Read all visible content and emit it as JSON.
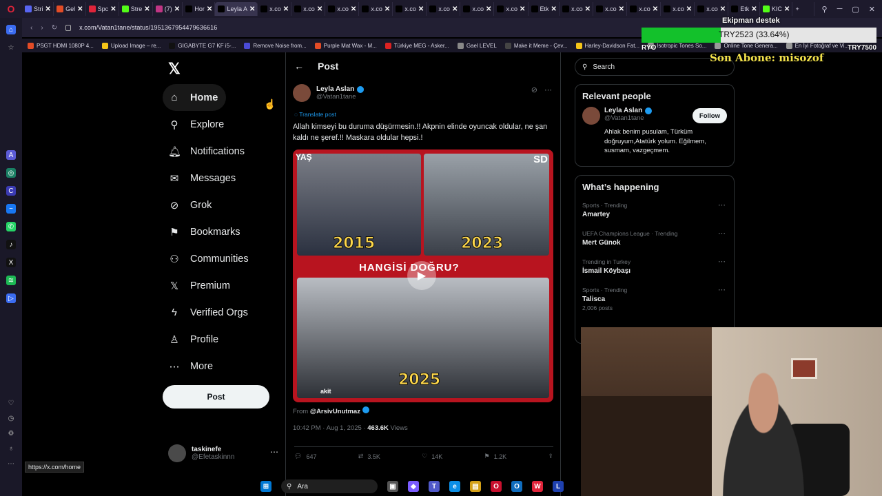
{
  "browser": {
    "tabs": [
      {
        "label": "Stri",
        "color": "#5865f2"
      },
      {
        "label": "Gel",
        "color": "#e34c26"
      },
      {
        "label": "Spc",
        "color": "#e0243a"
      },
      {
        "label": "Stre",
        "color": "#53fc18"
      },
      {
        "label": "(7)",
        "color": "#c13584"
      },
      {
        "label": "Hor",
        "color": "#000000"
      },
      {
        "label": "Leyla A",
        "color": "#000000",
        "active": true
      },
      {
        "label": "x.co",
        "color": "#000000"
      },
      {
        "label": "x.co",
        "color": "#000000"
      },
      {
        "label": "x.co",
        "color": "#000000"
      },
      {
        "label": "x.co",
        "color": "#000000"
      },
      {
        "label": "x.co",
        "color": "#000000"
      },
      {
        "label": "x.co",
        "color": "#000000"
      },
      {
        "label": "x.co",
        "color": "#000000"
      },
      {
        "label": "x.co",
        "color": "#000000"
      },
      {
        "label": "Etk",
        "color": "#000000"
      },
      {
        "label": "x.co",
        "color": "#000000"
      },
      {
        "label": "x.co",
        "color": "#000000"
      },
      {
        "label": "x.co",
        "color": "#000000"
      },
      {
        "label": "x.co",
        "color": "#000000"
      },
      {
        "label": "x.co",
        "color": "#000000"
      },
      {
        "label": "Etk",
        "color": "#000000"
      },
      {
        "label": "KIC",
        "color": "#53fc18"
      }
    ],
    "url": "x.com/Vatan1tane/status/1951367954479636616",
    "bookmarks": [
      {
        "label": "PSGT HDMI 1080P 4...",
        "color": "#e34c26"
      },
      {
        "label": "Upload Image – re...",
        "color": "#f5c518"
      },
      {
        "label": "GIGABYTE G7 KF i5-...",
        "color": "#111111"
      },
      {
        "label": "Remove Noise from...",
        "color": "#4b4bd6"
      },
      {
        "label": "Purple Mat Wax - M...",
        "color": "#e34c26"
      },
      {
        "label": "Türkiye MEG - Asker...",
        "color": "#d22"
      },
      {
        "label": "Gael LEVEL",
        "color": "#888"
      },
      {
        "label": "Make it Meme - Çev...",
        "color": "#444"
      },
      {
        "label": "Harley-Davidson Fat...",
        "color": "#f5c518"
      },
      {
        "label": "Isotropic Tones So...",
        "color": "#999"
      },
      {
        "label": "Online Tone Genera...",
        "color": "#999"
      },
      {
        "label": "En İyi Fotoğraf ve Vi...",
        "color": "#999"
      }
    ]
  },
  "x": {
    "nav": [
      {
        "label": "Home",
        "icon": "home-icon",
        "glyph": "⌂"
      },
      {
        "label": "Explore",
        "icon": "search-icon",
        "glyph": "⚲"
      },
      {
        "label": "Notifications",
        "icon": "bell-icon",
        "glyph": "🔔︎"
      },
      {
        "label": "Messages",
        "icon": "envelope-icon",
        "glyph": "✉"
      },
      {
        "label": "Grok",
        "icon": "grok-icon",
        "glyph": "⊘"
      },
      {
        "label": "Bookmarks",
        "icon": "bookmark-icon",
        "glyph": "⚑"
      },
      {
        "label": "Communities",
        "icon": "people-icon",
        "glyph": "⚇"
      },
      {
        "label": "Premium",
        "icon": "x-icon",
        "glyph": "𝕏"
      },
      {
        "label": "Verified Orgs",
        "icon": "lightning-icon",
        "glyph": "ϟ"
      },
      {
        "label": "Profile",
        "icon": "person-icon",
        "glyph": "♙"
      },
      {
        "label": "More",
        "icon": "more-circle-icon",
        "glyph": "⋯"
      }
    ],
    "post_button": "Post",
    "account": {
      "name": "taskinefe",
      "handle": "@Efetaskinnn"
    },
    "center": {
      "header": "Post",
      "author_name": "Leyla Aslan",
      "author_handle": "@Vatan1tane",
      "translate": "Translate post",
      "text": "Allah kimseyi bu duruma düşürmesin.!! Akpnin elinde oyuncak oldular, ne şan kaldı ne şeref.!! Maskara oldular hepsi.!",
      "media": {
        "years": [
          "2015",
          "2023",
          "2025"
        ],
        "caption": "HANGİSİ DOĞRU?",
        "logo": "SD",
        "tag": "akit"
      },
      "from_label": "From",
      "from_account": "@ArsivUnutmaz",
      "time": "10:42 PM · Aug 1, 2025 ·",
      "views_count": "463.6K",
      "views_label": "Views",
      "actions": {
        "replies": "647",
        "reposts": "3.5K",
        "likes": "14K",
        "bookmarks": "1.2K"
      }
    },
    "right": {
      "search_placeholder": "Search",
      "relevant_title": "Relevant people",
      "relevant": {
        "name": "Leyla Aslan",
        "handle": "@Vatan1tane",
        "follow": "Follow",
        "bio": "Ahlak benim pusulam, Türküm doğruyum,Atatürk yolum. Eğilmem, susmam, vazgeçmem."
      },
      "happening_title": "What’s happening",
      "trends": [
        {
          "category": "Sports · Trending",
          "name": "Amartey",
          "count": ""
        },
        {
          "category": "UEFA Champions League · Trending",
          "name": "Mert Günok",
          "count": ""
        },
        {
          "category": "Trending in Turkey",
          "name": "İsmail Köybaşı",
          "count": ""
        },
        {
          "category": "Sports · Trending",
          "name": "Talisca",
          "count": "2,006 posts"
        }
      ]
    }
  },
  "overlay": {
    "donation_title": "Ekipman destek",
    "donation_label": "TRY2523 (33.64%)",
    "donation_progress": 0.3364,
    "donation_min": "RYO",
    "donation_max": "TRY7500",
    "last_subscriber": "Son Abone: misozof"
  },
  "status_url": "https://x.com/home",
  "taskbar": {
    "search_label": "Ara"
  }
}
